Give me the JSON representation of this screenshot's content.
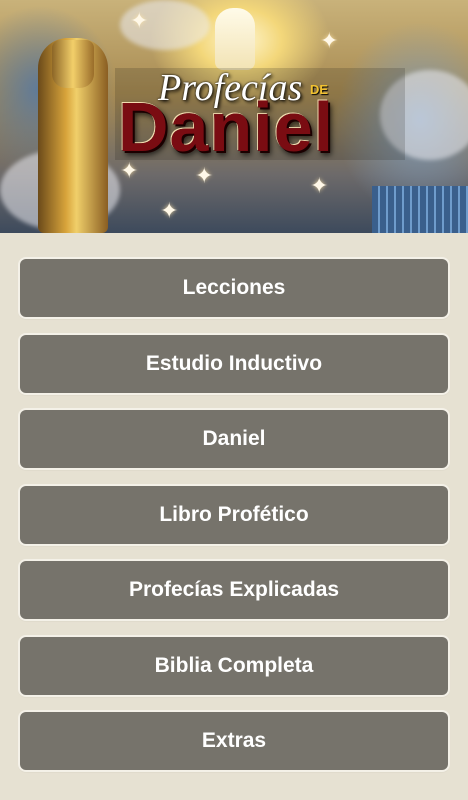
{
  "banner": {
    "title_script": "Profecías",
    "title_de": "DE",
    "title_main": "Daniel"
  },
  "menu": {
    "items": [
      {
        "label": "Lecciones"
      },
      {
        "label": "Estudio Inductivo"
      },
      {
        "label": "Daniel"
      },
      {
        "label": "Libro Profético"
      },
      {
        "label": "Profecías Explicadas"
      },
      {
        "label": "Biblia Completa"
      },
      {
        "label": "Extras"
      }
    ]
  },
  "colors": {
    "background": "#e6e1d2",
    "button": "#76736b",
    "button_text": "#ffffff",
    "title_red": "#7a0c12",
    "title_gold": "#f2c230"
  },
  "icons": [
    "statue-image",
    "angel-icon",
    "christ-figure-image"
  ]
}
